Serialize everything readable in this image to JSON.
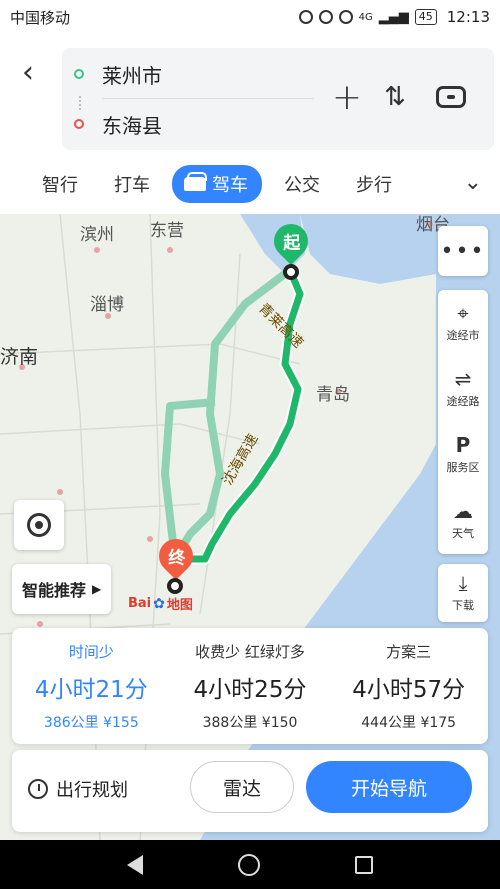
{
  "status_bar": {
    "carrier": "中国移动",
    "network": "4G",
    "battery": "45",
    "time": "12:13"
  },
  "header": {
    "back_icon": "chevron-left-icon",
    "start": "莱州市",
    "end": "东海县",
    "add_waypoint_icon": "plus-icon",
    "swap_icon": "swap-icon",
    "car_settings_icon": "car-settings-icon"
  },
  "tabs": {
    "items": [
      "智行",
      "打车",
      "驾车",
      "公交",
      "步行"
    ],
    "active": "驾车",
    "more_icon": "chevron-down-icon"
  },
  "map": {
    "cities": [
      "滨州",
      "东营",
      "烟台",
      "淄博",
      "济南",
      "青岛"
    ],
    "road_labels": [
      "青莱高速",
      "沈海高速"
    ],
    "start_pin": "起",
    "end_pin": "终",
    "logo": "Bai地图",
    "route_colors": {
      "selected": "#1fb86a",
      "alternate": "#8fd3b4",
      "sea": "#b6d2ef",
      "land": "#eef1ea"
    }
  },
  "side_tools": {
    "more_icon": "more-icon",
    "items": [
      {
        "label": "途经市",
        "icon": "pin-icon"
      },
      {
        "label": "途经路",
        "icon": "route-icon"
      },
      {
        "label": "服务区",
        "icon": "parking-icon"
      },
      {
        "label": "天气",
        "icon": "cloud-icon"
      }
    ],
    "download": "下载"
  },
  "smart_recommend": "智能推荐",
  "routes": [
    {
      "tag": "时间少",
      "duration": "4小时21分",
      "distance": "386公里",
      "toll": "¥155",
      "selected": true
    },
    {
      "tag": "收费少 红绿灯多",
      "duration": "4小时25分",
      "distance": "388公里",
      "toll": "¥150",
      "selected": false
    },
    {
      "tag": "方案三",
      "duration": "4小时57分",
      "distance": "444公里",
      "toll": "¥175",
      "selected": false
    }
  ],
  "actions": {
    "plan": "出行规划",
    "radar": "雷达",
    "navigate": "开始导航"
  }
}
